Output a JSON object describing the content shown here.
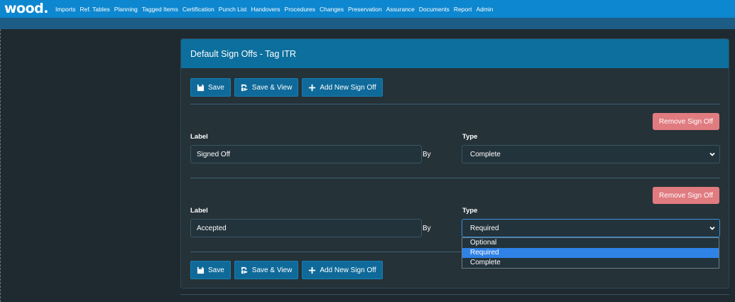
{
  "brand": {
    "logo_text": "wood"
  },
  "nav": {
    "items": [
      "Imports",
      "Ref. Tables",
      "Planning",
      "Tagged Items",
      "Certification",
      "Punch List",
      "Handovers",
      "Procedures",
      "Changes",
      "Preservation",
      "Assurance",
      "Documents",
      "Report",
      "Admin"
    ]
  },
  "card": {
    "title": "Default Sign Offs - Tag ITR"
  },
  "toolbar": {
    "save_label": "Save",
    "save_view_label": "Save & View",
    "add_label": "Add New Sign Off"
  },
  "signoffs": [
    {
      "remove_label": "Remove Sign Off",
      "label_heading": "Label",
      "label_value": "Signed Off",
      "by_text": "By",
      "type_heading": "Type",
      "type_value": "Complete"
    },
    {
      "remove_label": "Remove Sign Off",
      "label_heading": "Label",
      "label_value": "Accepted",
      "by_text": "By",
      "type_heading": "Type",
      "type_value": "Required"
    }
  ],
  "type_options": [
    "Optional",
    "Required",
    "Complete"
  ],
  "type_selected": "Required",
  "colors": {
    "nav_bg": "#0d87cf",
    "card_header": "#0c6f9d",
    "button": "#0f6a9a",
    "remove_button": "#e07b80",
    "option_highlight": "#2f82e6"
  }
}
